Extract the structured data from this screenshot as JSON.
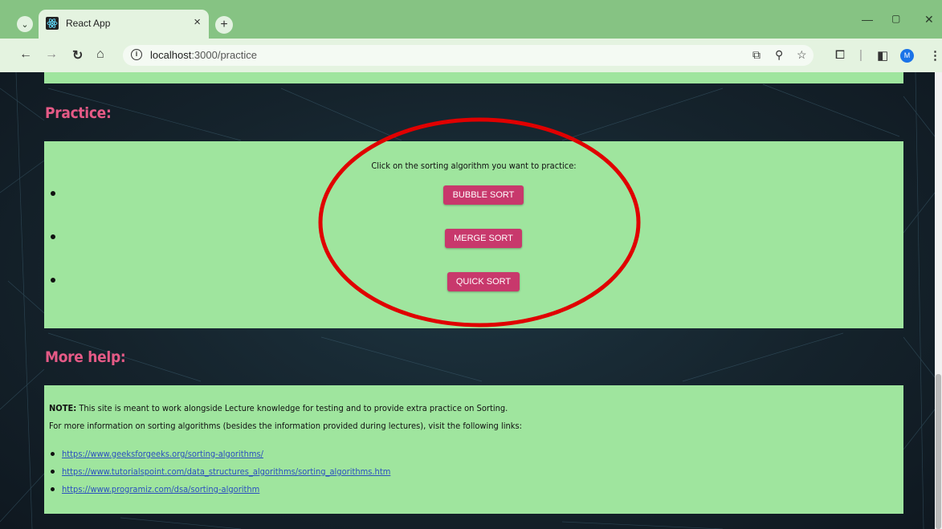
{
  "browser": {
    "tab_title": "React App",
    "tab_close": "×",
    "new_tab": "+",
    "url_host": "localhost",
    "url_path": ":3000/practice",
    "profile_initial": "M",
    "icons": [
      "tab-search-icon",
      "react-favicon-icon",
      "back-icon",
      "forward-icon",
      "reload-icon",
      "home-icon",
      "site-info-icon",
      "open-in-app-icon",
      "zoom-icon",
      "bookmark-star-icon",
      "extensions-icon",
      "side-panel-icon",
      "menu-icon",
      "minimize-icon",
      "restore-icon",
      "close-window-icon"
    ]
  },
  "page": {
    "practice_heading": "Practice:",
    "practice_prompt": "Click on the sorting algorithm you want to practice:",
    "buttons": [
      "BUBBLE SORT",
      "MERGE SORT",
      "QUICK SORT"
    ],
    "help_heading": "More help:",
    "note_label": "NOTE:",
    "note_text": " This site is meant to work alongside Lecture knowledge for testing and to provide extra practice on Sorting.",
    "info_text": "For more information on sorting algorithms (besides the information provided during lectures), visit the following links:",
    "links": [
      "https://www.geeksforgeeks.org/sorting-algorithms/",
      "https://www.tutorialspoint.com/data_structures_algorithms/sorting_algorithms.htm",
      "https://www.programiz.com/dsa/sorting-algorithm"
    ]
  },
  "colors": {
    "tabbar": "#86c383",
    "panel": "#9fe59e",
    "heading": "#e55a86",
    "button": "#c8386c",
    "annotation": "#e00000"
  }
}
